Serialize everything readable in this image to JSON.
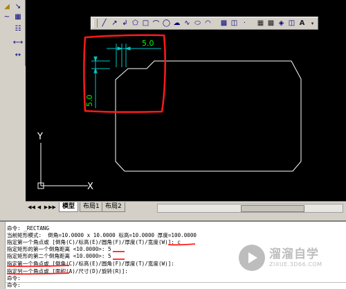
{
  "dimension": {
    "horizontal": "5.0",
    "vertical": "5.0"
  },
  "axes": {
    "y_label": "Y",
    "x_label": "X"
  },
  "tabs": [
    {
      "label": "模型",
      "active": true
    },
    {
      "label": "布局1",
      "active": false
    },
    {
      "label": "布局2",
      "active": false
    }
  ],
  "command_window": {
    "lines": [
      "命令: _RECTANG",
      "当前矩形模式:  倒角=10.0000 x 10.0000 标高=10.0000 厚度=100.0000",
      "指定第一个角点或 [倒角(C)/标高(E)/圆角(F)/厚度(T)/宽度(W)]: c",
      "指定矩形的第一个倒角距离 <10.0000>: 5",
      "指定矩形的第二个倒角距离 <10.0000>: 5",
      "指定第一个角点或 [倒角(C)/标高(E)/圆角(F)/厚度(T)/宽度(W)]:",
      "指定另一个角点或 [面积(A)/尺寸(D)/旋转(R)]:",
      "命令:",
      "命令:"
    ]
  },
  "watermark": {
    "main": "溜溜自学",
    "sub": "ZIXUE.3D66.COM"
  },
  "colors": {
    "canvas": "#000000",
    "rectangle": "#ffffff",
    "dimension": "#00c8c8",
    "dimension_text": "#00ff00",
    "annotation": "#ff1a1a",
    "ui_face": "#d4d0c8"
  },
  "icons": {
    "left_toolbar": [
      "dimension-icon",
      "leader-icon",
      "spline-icon",
      "hatch-icon",
      "table-icon",
      "aligned-dimension-icon"
    ],
    "float_toolbar": [
      "line-icon",
      "construction-line-icon",
      "polyline-icon",
      "polygon-icon",
      "rectangle-icon",
      "arc-icon",
      "circle-icon",
      "revision-cloud-icon",
      "spline-icon",
      "ellipse-icon",
      "ellipse-arc-icon",
      "insert-block-icon",
      "make-block-icon",
      "point-icon",
      "hatch-icon",
      "gradient-icon",
      "region-icon",
      "table-icon",
      "multiline-text-icon"
    ]
  }
}
